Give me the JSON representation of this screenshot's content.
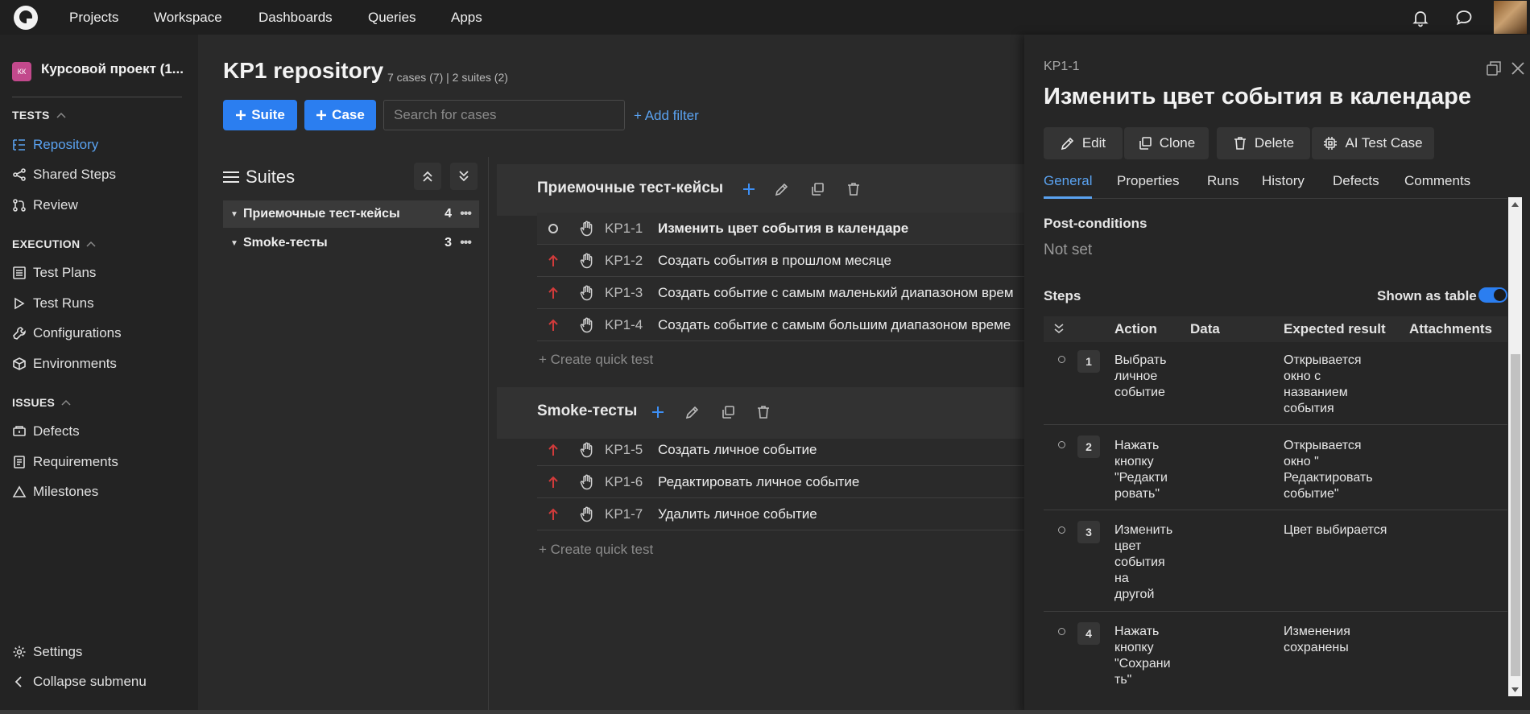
{
  "topbar": {
    "nav": [
      "Projects",
      "Workspace",
      "Dashboards",
      "Queries",
      "Apps"
    ]
  },
  "sidebar": {
    "project_badge": "КК",
    "project_name": "Курсовой проект (1...",
    "sections": {
      "tests": "TESTS",
      "execution": "EXECUTION",
      "issues": "ISSUES"
    },
    "items": {
      "repository": "Repository",
      "shared_steps": "Shared Steps",
      "review": "Review",
      "test_plans": "Test Plans",
      "test_runs": "Test Runs",
      "configurations": "Configurations",
      "environments": "Environments",
      "defects": "Defects",
      "requirements": "Requirements",
      "milestones": "Milestones",
      "settings": "Settings",
      "collapse": "Collapse submenu"
    }
  },
  "main": {
    "title": "KP1 repository",
    "meta": "7 cases (7) | 2 suites (2)",
    "suite_btn": "Suite",
    "case_btn": "Case",
    "search_placeholder": "Search for cases",
    "add_filter": "+ Add filter",
    "suites_label": "Suites",
    "tree": [
      {
        "name": "Приемочные тест-кейсы",
        "count": "4"
      },
      {
        "name": "Smoke-тесты",
        "count": "3"
      }
    ],
    "suites": [
      {
        "name": "Приемочные тест-кейсы",
        "cases": [
          {
            "id": "KP1-1",
            "title": "Изменить цвет события в календаре"
          },
          {
            "id": "KP1-2",
            "title": "Создать события в прошлом месяце"
          },
          {
            "id": "KP1-3",
            "title": "Создать событие с самым маленький диапазоном врем"
          },
          {
            "id": "KP1-4",
            "title": "Создать событие с самым большим диапазоном време"
          }
        ]
      },
      {
        "name": "Smoke-тесты",
        "cases": [
          {
            "id": "KP1-5",
            "title": "Создать личное событие"
          },
          {
            "id": "KP1-6",
            "title": "Редактировать личное событие"
          },
          {
            "id": "KP1-7",
            "title": "Удалить личное событие"
          }
        ]
      }
    ],
    "quick_create": "+ Create quick test"
  },
  "panel": {
    "case_id": "KP1-1",
    "title": "Изменить цвет события в календаре",
    "buttons": {
      "edit": "Edit",
      "clone": "Clone",
      "delete": "Delete",
      "ai": "AI Test Case"
    },
    "tabs": [
      "General",
      "Properties",
      "Runs",
      "History",
      "Defects",
      "Comments"
    ],
    "post_conditions_label": "Post-conditions",
    "post_conditions_value": "Not set",
    "steps_label": "Steps",
    "shown_as_table": "Shown as table",
    "columns": {
      "action": "Action",
      "data": "Data",
      "expected": "Expected result",
      "attachments": "Attachments"
    },
    "steps": [
      {
        "num": "1",
        "action": "Выбрать\nличное\nсобытие",
        "expected": "Открывается\nокно с\nназванием\nсобытия"
      },
      {
        "num": "2",
        "action": "Нажать\nкнопку\n\"Редакти\nровать\"",
        "expected": "Открывается\nокно \"\nРедактировать\nсобытие\""
      },
      {
        "num": "3",
        "action": "Изменить\nцвет\nсобытия\nна\nдругой",
        "expected": "Цвет выбирается"
      },
      {
        "num": "4",
        "action": "Нажать\nкнопку\n\"Сохрани\nть\"",
        "expected": "Изменения\nсохранены"
      }
    ]
  },
  "colors": {
    "accent": "#2b7ef0",
    "link": "#5aa2f0",
    "priority_high": "#d23b3b"
  }
}
